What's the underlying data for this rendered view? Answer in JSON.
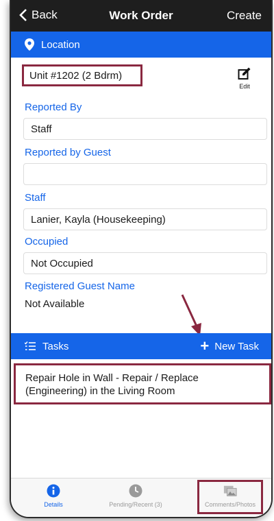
{
  "navbar": {
    "back_label": "Back",
    "title": "Work Order",
    "create_label": "Create"
  },
  "location_section": {
    "label": "Location",
    "unit": "Unit #1202 (2 Bdrm)",
    "edit_label": "Edit"
  },
  "fields": {
    "reported_by": {
      "label": "Reported By",
      "value": "Staff"
    },
    "reported_by_guest": {
      "label": "Reported by Guest",
      "value": ""
    },
    "staff": {
      "label": "Staff",
      "value": "Lanier, Kayla (Housekeeping)"
    },
    "occupied": {
      "label": "Occupied",
      "value": "Not Occupied"
    },
    "registered_guest": {
      "label": "Registered Guest Name",
      "value": "Not Available"
    }
  },
  "tasks_section": {
    "label": "Tasks",
    "new_task_label": "New Task",
    "items": [
      {
        "text": "Repair Hole in Wall - Repair / Replace (Engineering) in the Living Room"
      }
    ]
  },
  "tabbar": {
    "tabs": [
      {
        "label": "Details",
        "icon": "info-icon",
        "active": true
      },
      {
        "label": "Pending/Recent (3)",
        "icon": "clock-icon",
        "active": false
      },
      {
        "label": "Comments/Photos",
        "icon": "photos-icon",
        "active": false
      }
    ]
  },
  "colors": {
    "accent": "#1565e8",
    "highlight": "#8a2840",
    "navbar": "#1e1e1e"
  }
}
